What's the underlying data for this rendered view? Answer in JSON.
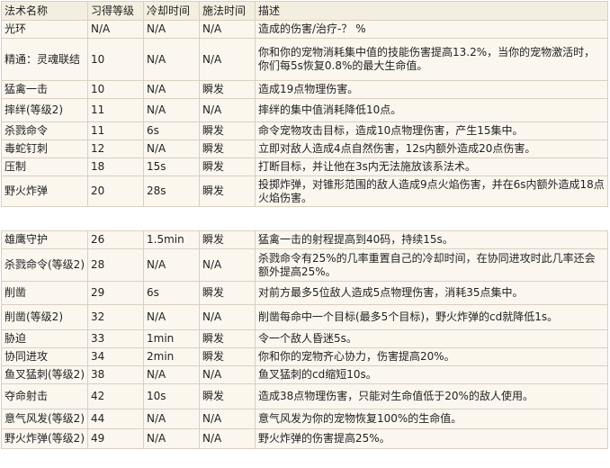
{
  "headers": [
    "法术名称",
    "习得等级",
    "冷却时间",
    "施法时间",
    "描述"
  ],
  "table1": [
    [
      "光环",
      "N/A",
      "N/A",
      "N/A",
      "造成的伤害/治疗-？ %"
    ],
    [
      "精通：灵魂联结",
      "10",
      "N/A",
      "N/A",
      "你和你的宠物消耗集中值的技能伤害提高13.2%，当你的宠物激活时，你们每5s恢复0.8%的最大生命值。"
    ],
    [
      "猛禽一击",
      "10",
      "N/A",
      "瞬发",
      "造成19点物理伤害。"
    ],
    [
      "摔绊(等级2)",
      "11",
      "N/A",
      "N/A",
      "摔绊的集中值消耗降低10点。"
    ],
    [
      "杀戮命令",
      "11",
      "6s",
      "瞬发",
      "命令宠物攻击目标，造成10点物理伤害，产生15集中。"
    ],
    [
      "毒蛇钉刺",
      "12",
      "N/A",
      "瞬发",
      "立即对敌人造成4点自然伤害，12s内额外造成20点伤害。"
    ],
    [
      "压制",
      "18",
      "15s",
      "瞬发",
      "打断目标，并让他在3s内无法施放该系法术。"
    ],
    [
      "野火炸弹",
      "20",
      "28s",
      "瞬发",
      "投掷炸弹，对锥形范围的敌人造成9点火焰伤害，并在6s内额外造成18点火焰伤害。"
    ]
  ],
  "table2": [
    [
      "雄鹰守护",
      "26",
      "1.5min",
      "瞬发",
      "猛禽一击的射程提高到40码，持续15s。"
    ],
    [
      "杀戮命令(等级2)",
      "28",
      "N/A",
      "N/A",
      "杀戮命令有25%的几率重置自己的冷却时间，在协同进攻时此几率还会额外提高25%。"
    ],
    [
      "削凿",
      "29",
      "6s",
      "瞬发",
      "对前方最多5位敌人造成5点物理伤害，消耗35点集中。"
    ],
    [
      "削凿(等级2)",
      "32",
      "N/A",
      "N/A",
      "削凿每命中一个目标(最多5个目标)，野火炸弹的cd就降低1s。"
    ],
    [
      "胁迫",
      "33",
      "1min",
      "瞬发",
      "令一个敌人昏迷5s。"
    ],
    [
      "协同进攻",
      "34",
      "2min",
      "瞬发",
      "你和你的宠物齐心协力，伤害提高20%。"
    ],
    [
      "鱼叉猛刺(等级2)",
      "38",
      "N/A",
      "N/A",
      "鱼叉猛刺的cd缩短10s。"
    ],
    [
      "夺命射击",
      "42",
      "10s",
      "瞬发",
      "造成38点物理伤害，只能对生命值低于20%的敌人使用。"
    ],
    [
      "意气风发(等级2)",
      "44",
      "N/A",
      "N/A",
      "意气风发为你的宠物恢复100%的生命值。"
    ],
    [
      "野火炸弹(等级2)",
      "49",
      "N/A",
      "N/A",
      "野火炸弹的伤害提高25%。"
    ]
  ]
}
